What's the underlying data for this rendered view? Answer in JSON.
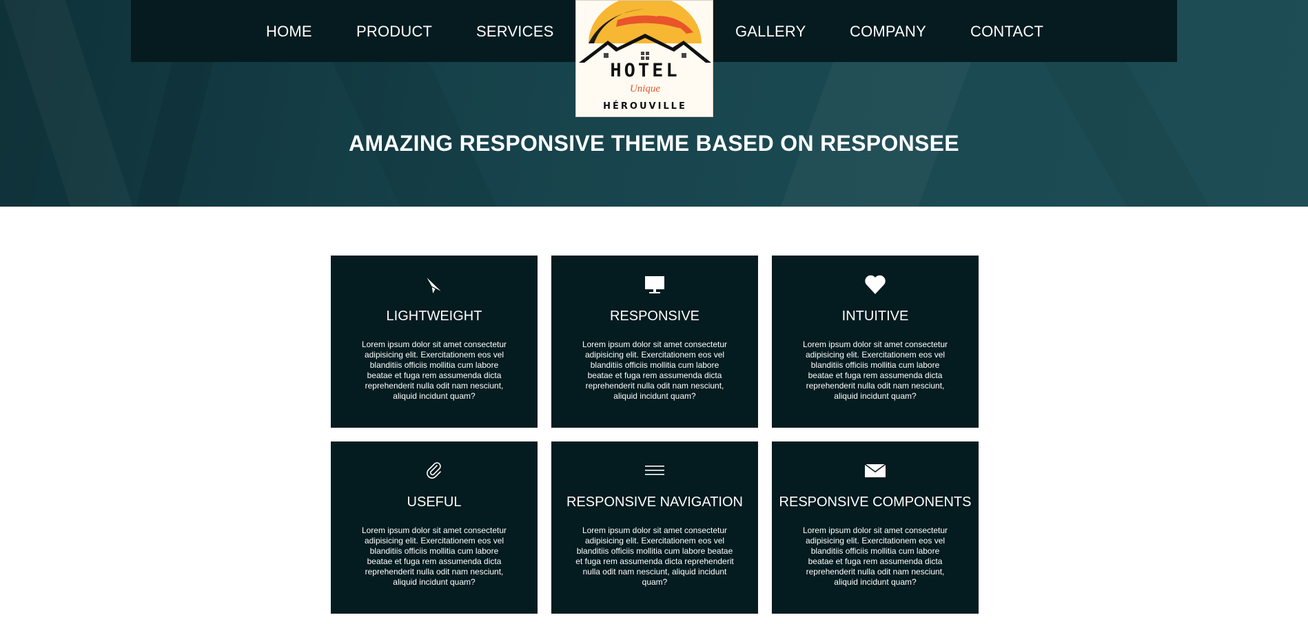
{
  "nav": {
    "left": [
      {
        "label": "HOME",
        "name": "nav-home"
      },
      {
        "label": "PRODUCT",
        "name": "nav-product"
      },
      {
        "label": "SERVICES",
        "name": "nav-services"
      }
    ],
    "right": [
      {
        "label": "GALLERY",
        "name": "nav-gallery"
      },
      {
        "label": "COMPANY",
        "name": "nav-company"
      },
      {
        "label": "CONTACT",
        "name": "nav-contact"
      }
    ]
  },
  "logo": {
    "line1": "HOTEL",
    "line2": "Unique",
    "line3": "HÉROUVILLE",
    "colors": {
      "sun": "#f7b733",
      "sunset": "#e8552a",
      "ink": "#111111",
      "accent": "#e1552b"
    }
  },
  "hero": {
    "title": "AMAZING RESPONSIVE THEME BASED ON RESPONSEE"
  },
  "features": [
    {
      "icon": "paper-plane-icon",
      "title": "LIGHTWEIGHT",
      "text": "Lorem ipsum dolor sit amet consectetur adipisicing elit. Exercitationem eos vel blanditiis officiis mollitia cum labore beatae et fuga rem assumenda dicta reprehenderit nulla odit nam nesciunt, aliquid incidunt quam?"
    },
    {
      "icon": "monitor-icon",
      "title": "RESPONSIVE",
      "text": "Lorem ipsum dolor sit amet consectetur adipisicing elit. Exercitationem eos vel blanditiis officiis mollitia cum labore beatae et fuga rem assumenda dicta reprehenderit nulla odit nam nesciunt, aliquid incidunt quam?"
    },
    {
      "icon": "heart-icon",
      "title": "INTUITIVE",
      "text": "Lorem ipsum dolor sit amet consectetur adipisicing elit. Exercitationem eos vel blanditiis officiis mollitia cum labore beatae et fuga rem assumenda dicta reprehenderit nulla odit nam nesciunt, aliquid incidunt quam?"
    },
    {
      "icon": "paperclip-icon",
      "title": "USEFUL",
      "text": "Lorem ipsum dolor sit amet consectetur adipisicing elit. Exercitationem eos vel blanditiis officiis mollitia cum labore beatae et fuga rem assumenda dicta reprehenderit nulla odit nam nesciunt, aliquid incidunt quam?"
    },
    {
      "icon": "menu-icon",
      "title": "RESPONSIVE NAVIGATION",
      "text": "Lorem ipsum dolor sit amet consectetur adipisicing elit. Exercitationem eos vel blanditiis officiis mollitia cum labore beatae et fuga rem assumenda dicta reprehenderit nulla odit nam nesciunt, aliquid incidunt quam?"
    },
    {
      "icon": "envelope-icon",
      "title": "RESPONSIVE COMPONENTS",
      "text": "Lorem ipsum dolor sit amet consectetur adipisicing elit. Exercitationem eos vel blanditiis officiis mollitia cum labore beatae et fuga rem assumenda dicta reprehenderit nulla odit nam nesciunt, aliquid incidunt quam?"
    }
  ],
  "colors": {
    "nav_bg": "#051b20",
    "hero_bg": "#16414a",
    "card_bg": "#041b1f",
    "text": "#ffffff"
  }
}
